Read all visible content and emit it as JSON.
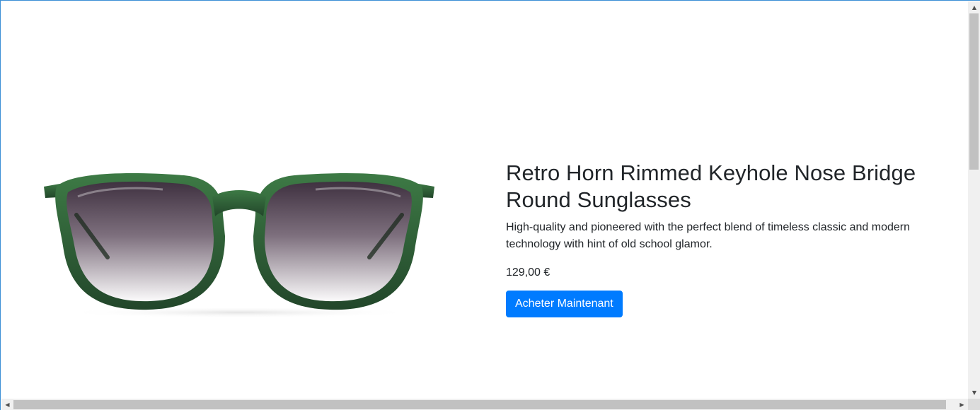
{
  "product": {
    "title": "Retro Horn Rimmed Keyhole Nose Bridge Round Sunglasses",
    "description": "High-quality and pioneered with the perfect blend of timeless classic and modern technology with hint of old school glamor.",
    "price": "129,00 €",
    "buy_label": "Acheter Maintenant",
    "image_icon": "sunglasses-image",
    "frame_color": "#2f5d34",
    "button_color": "#007bff"
  },
  "scrollbars": {
    "up_icon": "▲",
    "down_icon": "▼",
    "left_icon": "◀",
    "right_icon": "▶"
  }
}
